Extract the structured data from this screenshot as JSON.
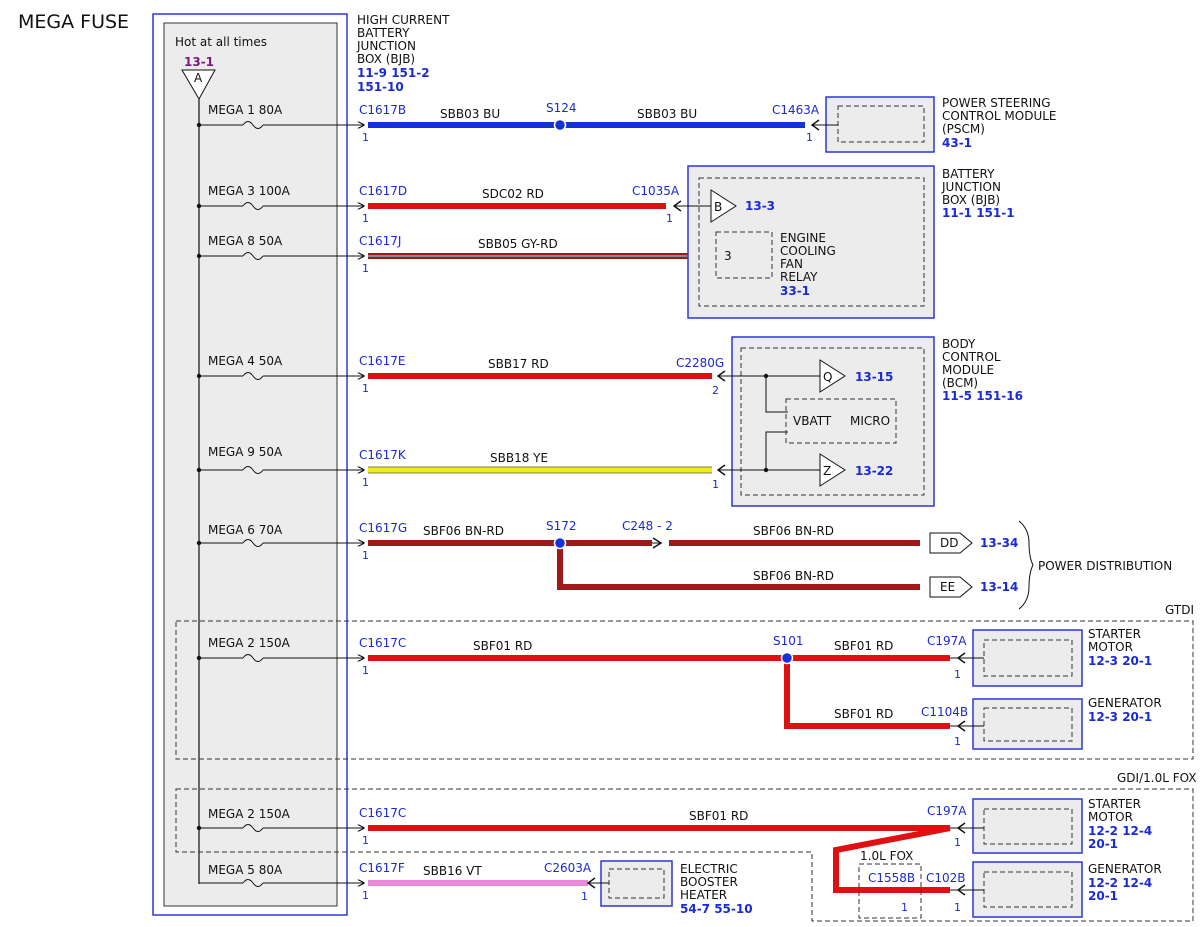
{
  "title": "MEGA FUSE",
  "bjb": {
    "hot_label": "Hot at all times",
    "ref": "13-1",
    "pin": "A",
    "name_lines": [
      "HIGH CURRENT",
      "BATTERY",
      "JUNCTION",
      "BOX (BJB)"
    ],
    "refs": [
      "11-9  151-2",
      "151-10"
    ]
  },
  "fuses": {
    "f1": "MEGA 1   80A",
    "f3": "MEGA 3   100A",
    "f8": "MEGA 8   50A",
    "f4": "MEGA 4   50A",
    "f9": "MEGA 9   50A",
    "f6": "MEGA 6   70A",
    "f2a": "MEGA 2   150A",
    "f2b": "MEGA 2   150A",
    "f5": "MEGA 5   80A"
  },
  "circuits": {
    "sbb03_a": "SBB03   BU",
    "sbb03_b": "SBB03   BU",
    "sdc02": "SDC02   RD",
    "sbb05": "SBB05   GY-RD",
    "sbb17": "SBB17   RD",
    "sbb18": "SBB18   YE",
    "sbf06_a": "SBF06   BN-RD",
    "sbf06_b": "SBF06   BN-RD",
    "sbf06_c": "SBF06   BN-RD",
    "sbf01_a": "SBF01   RD",
    "sbf01_b": "SBF01   RD",
    "sbf01_c": "SBF01   RD",
    "sbf01_d": "SBF01   RD",
    "sbb16": "SBB16   VT"
  },
  "connectors": {
    "c1617b": "C1617B",
    "c1617d": "C1617D",
    "c1617j": "C1617J",
    "c1617e": "C1617E",
    "c1617k": "C1617K",
    "c1617g": "C1617G",
    "c1617c_a": "C1617C",
    "c1617c_b": "C1617C",
    "c1617f": "C1617F",
    "c1463a": "C1463A",
    "c1035a": "C1035A",
    "c2280g": "C2280G",
    "c248": "C248 - 2",
    "c197a_a": "C197A",
    "c197a_b": "C197A",
    "c1104b": "C1104B",
    "c1558b": "C1558B",
    "c102b": "C102B",
    "c2603a": "C2603A"
  },
  "splices": {
    "s124": "S124",
    "s172": "S172",
    "s101": "S101"
  },
  "pins": {
    "one": "1",
    "two": "2",
    "three": "3"
  },
  "modules": {
    "pscm": {
      "lines": [
        "POWER STEERING",
        "CONTROL MODULE",
        "(PSCM)"
      ],
      "ref": "43-1"
    },
    "bjb2": {
      "lines": [
        "BATTERY",
        "JUNCTION",
        "BOX (BJB)"
      ],
      "ref": "11-1   151-1",
      "pin_b": "B",
      "pin_b_ref": "13-3"
    },
    "relay": {
      "lines": [
        "ENGINE",
        "COOLING",
        "FAN",
        "RELAY"
      ],
      "ref": "33-1"
    },
    "bcm": {
      "lines": [
        "BODY",
        "CONTROL",
        "MODULE",
        "(BCM)"
      ],
      "ref": "11-5    151-16",
      "q": "Q",
      "q_ref": "13-15",
      "z": "Z",
      "z_ref": "13-22",
      "vbatt": "VBATT",
      "micro": "MICRO"
    },
    "dist": {
      "dd": "DD",
      "dd_ref": "13-34",
      "ee": "EE",
      "ee_ref": "13-14",
      "label": "POWER DISTRIBUTION"
    },
    "starter1": {
      "lines": [
        "STARTER",
        "MOTOR"
      ],
      "ref": "12-3   20-1"
    },
    "gen1": {
      "lines": [
        "GENERATOR"
      ],
      "ref": "12-3   20-1"
    },
    "starter2": {
      "lines": [
        "STARTER",
        "MOTOR"
      ],
      "ref1": "12-2   12-4",
      "ref2": "20-1"
    },
    "gen2": {
      "lines": [
        "GENERATOR"
      ],
      "ref1": "12-2   12-4",
      "ref2": "20-1"
    },
    "heater": {
      "lines": [
        "ELECTRIC",
        "BOOSTER",
        "HEATER"
      ],
      "ref": "54-7   55-10"
    }
  },
  "variants": {
    "gtdi": "GTDI",
    "gdi": "GDI/1.0L FOX",
    "fox": "1.0L FOX"
  },
  "colors": {
    "blue_wire": "#1432d8",
    "red_wire": "#e01010",
    "brown_wire": "#9e1a1a",
    "yellow_wire": "#f2ec10",
    "violet_wire": "#e88ad8",
    "gray_wire": "#8a8a8a",
    "frame_blue": "#2a38d8",
    "module_fill": "#ececec"
  }
}
